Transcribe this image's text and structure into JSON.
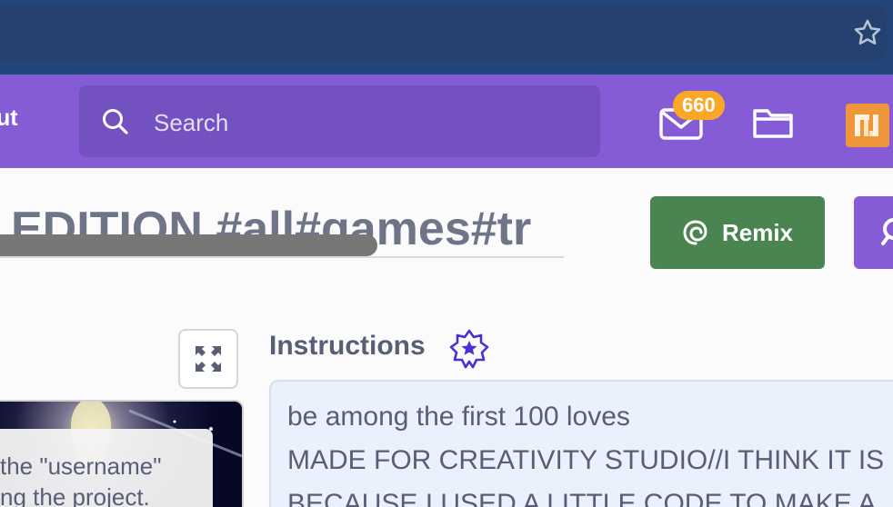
{
  "nav": {
    "partial_label": "ut",
    "search": {
      "placeholder": "Search"
    },
    "messages": {
      "count": "660",
      "icon": "envelope-icon"
    },
    "mystuff_icon": "folder-icon",
    "avatar_icon": "user-avatar"
  },
  "browser": {
    "bookmark_icon": "star-outline-icon"
  },
  "project": {
    "title": "EDITION #all#games#tr",
    "remix_label": "Remix"
  },
  "stage": {
    "caption_lines": [
      "the \"username\"",
      "ng the project."
    ]
  },
  "instructions": {
    "heading": "Instructions",
    "lines": [
      "be among the first 100 loves",
      "MADE FOR CREATIVITY STUDIO//I THINK IT IS",
      "BECAUSE I USED A LITTLE CODE TO MAKE A"
    ]
  },
  "colors": {
    "nav_purple": "#855cd6",
    "search_bg": "#7451c0",
    "remix_green": "#4a8450",
    "badge_orange": "#f9a825",
    "browser_blue": "#22467a"
  }
}
